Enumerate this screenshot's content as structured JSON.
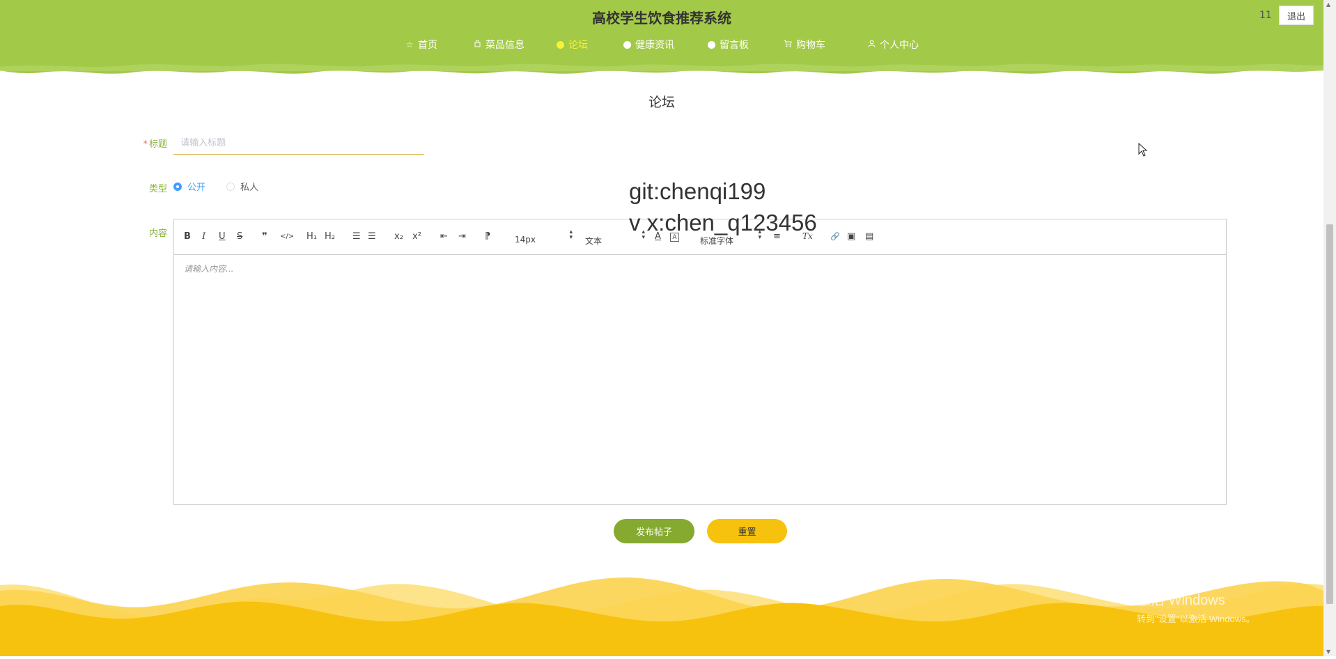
{
  "header": {
    "title": "高校学生饮食推荐系统",
    "user_count": "11",
    "logout_label": "退出",
    "bg_color": "#a3c948",
    "nav": [
      {
        "label": "首页",
        "icon": "star-icon",
        "active": false
      },
      {
        "label": "菜品信息",
        "icon": "bag-icon",
        "active": false
      },
      {
        "label": "论坛",
        "icon": "circle-icon",
        "active": true
      },
      {
        "label": "健康资讯",
        "icon": "circle-icon",
        "active": false
      },
      {
        "label": "留言板",
        "icon": "circle-icon",
        "active": false
      },
      {
        "label": "购物车",
        "icon": "cart-icon",
        "active": false
      },
      {
        "label": "个人中心",
        "icon": "user-icon",
        "active": false
      }
    ]
  },
  "page_title": "论坛",
  "form": {
    "title_label": "标题",
    "title_required_mark": "*",
    "title_placeholder": "请输入标题",
    "type_label": "类型",
    "type_options": [
      {
        "label": "公开",
        "checked": true
      },
      {
        "label": "私人",
        "checked": false
      }
    ],
    "content_label": "内容",
    "editor": {
      "placeholder": "请输入内容...",
      "toolbar": {
        "bold": "B",
        "italic": "I",
        "underline": "U",
        "strike": "S",
        "quote": "❞",
        "code": "</>",
        "h1": "H₁",
        "h2": "H₂",
        "ordered_list": "☰",
        "bullet_list": "☰",
        "sub": "x₂",
        "sup": "x²",
        "outdent": "⇤",
        "indent": "⇥",
        "direction": "⁋",
        "font_size": "14px",
        "header_select": "文本",
        "color": "A",
        "background": "A",
        "font_family": "标准字体",
        "align": "≡",
        "clean": "Tx",
        "link": "🔗",
        "image": "▣",
        "video": "▤"
      }
    }
  },
  "buttons": {
    "publish": "发布帖子",
    "reset": "重置"
  },
  "watermark": {
    "line1": "git:chenqi199",
    "line2": "v x:chen_q123456"
  },
  "windows_activation": {
    "line1": "激活 Windows",
    "line2": "转到\"设置\"以激活 Windows。"
  },
  "colors": {
    "accent_green": "#a3c948",
    "publish_green": "#86a92f",
    "footer_yellow": "#f7c20e",
    "active_nav": "#f7f33a"
  }
}
